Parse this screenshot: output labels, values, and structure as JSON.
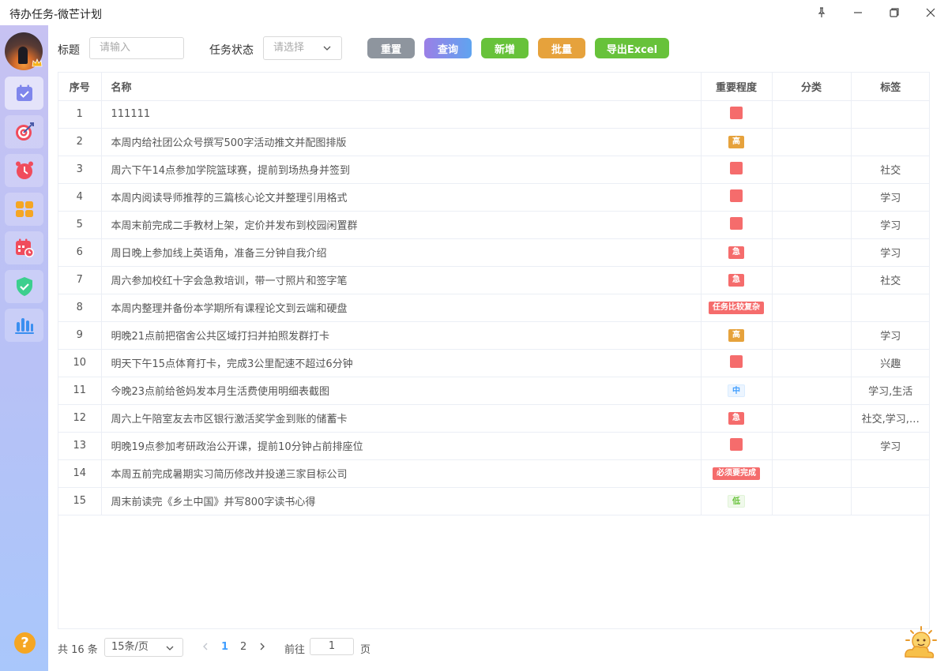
{
  "window": {
    "title": "待办任务-微芒计划"
  },
  "sidebar": {
    "items": [
      {
        "name": "todo",
        "icon": "calendar-check-icon",
        "active": true
      },
      {
        "name": "goals",
        "icon": "target-icon"
      },
      {
        "name": "alarm",
        "icon": "alarm-clock-icon"
      },
      {
        "name": "apps",
        "icon": "grid-icon"
      },
      {
        "name": "schedule",
        "icon": "calendar-clock-icon"
      },
      {
        "name": "shield",
        "icon": "shield-check-icon"
      },
      {
        "name": "stats",
        "icon": "bar-chart-icon"
      }
    ],
    "help_icon": "question-icon",
    "help_text": "?"
  },
  "toolbar": {
    "title_label": "标题",
    "title_placeholder": "请输入",
    "status_label": "任务状态",
    "status_placeholder": "请选择",
    "reset": "重置",
    "query": "查询",
    "add": "新增",
    "batch": "批量",
    "export": "导出Excel"
  },
  "table": {
    "headers": {
      "index": "序号",
      "name": "名称",
      "importance": "重要程度",
      "category": "分类",
      "tags": "标签"
    },
    "rows": [
      {
        "index": "1",
        "name": "111111",
        "importance": "",
        "importance_style": "red-block",
        "category": "",
        "tags": ""
      },
      {
        "index": "2",
        "name": "本周内给社团公众号撰写500字活动推文并配图排版",
        "importance": "高",
        "importance_style": "orange",
        "category": "",
        "tags": ""
      },
      {
        "index": "3",
        "name": "周六下午14点参加学院篮球赛，提前到场热身并签到",
        "importance": "",
        "importance_style": "red-block",
        "category": "",
        "tags": "社交"
      },
      {
        "index": "4",
        "name": "本周内阅读导师推荐的三篇核心论文并整理引用格式",
        "importance": "",
        "importance_style": "red-block",
        "category": "",
        "tags": "学习"
      },
      {
        "index": "5",
        "name": "本周末前完成二手教材上架，定价并发布到校园闲置群",
        "importance": "",
        "importance_style": "red-block",
        "category": "",
        "tags": "学习"
      },
      {
        "index": "6",
        "name": "周日晚上参加线上英语角，准备三分钟自我介绍",
        "importance": "急",
        "importance_style": "red",
        "category": "",
        "tags": "学习"
      },
      {
        "index": "7",
        "name": "周六参加校红十字会急救培训，带一寸照片和签字笔",
        "importance": "急",
        "importance_style": "red",
        "category": "",
        "tags": "社交"
      },
      {
        "index": "8",
        "name": "本周内整理并备份本学期所有课程论文到云端和硬盘",
        "importance": "任务比较复杂",
        "importance_style": "red",
        "category": "",
        "tags": ""
      },
      {
        "index": "9",
        "name": "明晚21点前把宿舍公共区域打扫并拍照发群打卡",
        "importance": "高",
        "importance_style": "orange",
        "category": "",
        "tags": "学习"
      },
      {
        "index": "10",
        "name": "明天下午15点体育打卡，完成3公里配速不超过6分钟",
        "importance": "",
        "importance_style": "red-block",
        "category": "",
        "tags": "兴趣"
      },
      {
        "index": "11",
        "name": "今晚23点前给爸妈发本月生活费使用明细表截图",
        "importance": "中",
        "importance_style": "mid",
        "category": "",
        "tags": "学习,生活"
      },
      {
        "index": "12",
        "name": "周六上午陪室友去市区银行激活奖学金到账的储蓄卡",
        "importance": "急",
        "importance_style": "red",
        "category": "",
        "tags": "社交,学习,…"
      },
      {
        "index": "13",
        "name": "明晚19点参加考研政治公开课，提前10分钟占前排座位",
        "importance": "",
        "importance_style": "red-block",
        "category": "",
        "tags": "学习"
      },
      {
        "index": "14",
        "name": "本周五前完成暑期实习简历修改并投递三家目标公司",
        "importance": "必须要完成",
        "importance_style": "red",
        "category": "",
        "tags": ""
      },
      {
        "index": "15",
        "name": "周末前读完《乡土中国》并写800字读书心得",
        "importance": "低",
        "importance_style": "low",
        "category": "",
        "tags": ""
      }
    ]
  },
  "pagination": {
    "total": "共 16 条",
    "page_size": "15条/页",
    "pages": [
      "1",
      "2"
    ],
    "current": "1",
    "goto_label": "前往",
    "goto_value": "1",
    "page_suffix": "页"
  },
  "colors": {
    "reset": "#8e959e",
    "query": "#7b8cf0",
    "add": "#67c23a",
    "batch": "#e6a23c",
    "export": "#67c23a",
    "active_page": "#409eff"
  }
}
